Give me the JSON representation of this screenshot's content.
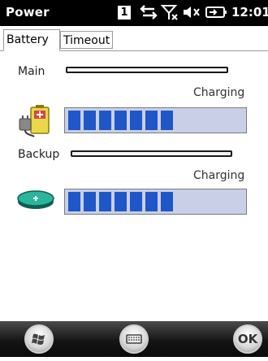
{
  "statusbar": {
    "title": "Power",
    "badge": "1",
    "clock": "12:01",
    "icons": [
      "sync-arrows-icon",
      "signal-off-icon",
      "volume-muted-icon",
      "battery-charging-icon"
    ]
  },
  "tabs": [
    {
      "label": "Battery"
    },
    {
      "label": "Timeout"
    }
  ],
  "main_battery": {
    "label": "Main",
    "status": "Charging",
    "level": 0.6,
    "icon": "battery-plug-icon"
  },
  "backup_battery": {
    "label": "Backup",
    "status": "Charging",
    "level": 0.6,
    "icon": "coin-cell-battery-icon"
  },
  "taskbar": {
    "start_icon": "windows-start-icon",
    "keyboard_icon": "keyboard-icon",
    "ok_label": "OK"
  },
  "colors": {
    "meter_fill": "#1f57c8",
    "meter_bg": "#c9cfe6",
    "statusbar": "#000000"
  }
}
